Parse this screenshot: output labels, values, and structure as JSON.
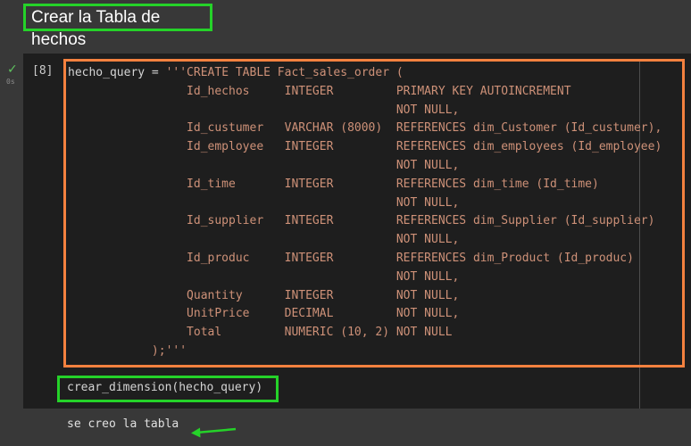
{
  "markdown_cell": {
    "title": "Crear la Tabla de hechos"
  },
  "code_cell": {
    "exec_count": "[8]",
    "exec_time": "0s",
    "code_lines": [
      "hecho_query = '''CREATE TABLE Fact_sales_order (",
      "                 Id_hechos     INTEGER         PRIMARY KEY AUTOINCREMENT",
      "                                               NOT NULL,",
      "                 Id_custumer   VARCHAR (8000)  REFERENCES dim_Customer (Id_custumer),",
      "                 Id_employee   INTEGER         REFERENCES dim_employees (Id_employee)",
      "                                               NOT NULL,",
      "                 Id_time       INTEGER         REFERENCES dim_time (Id_time)",
      "                                               NOT NULL,",
      "                 Id_supplier   INTEGER         REFERENCES dim_Supplier (Id_supplier)",
      "                                               NOT NULL,",
      "                 Id_produc     INTEGER         REFERENCES dim_Product (Id_produc)",
      "                                               NOT NULL,",
      "                 Quantity      INTEGER         NOT NULL,",
      "                 UnitPrice     DECIMAL         NOT NULL,",
      "                 Total         NUMERIC (10, 2) NOT NULL",
      "            );'''"
    ],
    "call_line": "crear_dimension(hecho_query)"
  },
  "output": {
    "text": "se creo la tabla"
  },
  "colors": {
    "highlight_green": "#25d229",
    "highlight_orange": "#f4813f",
    "string_color": "#ce9178",
    "code_text": "#d4d4d4"
  }
}
